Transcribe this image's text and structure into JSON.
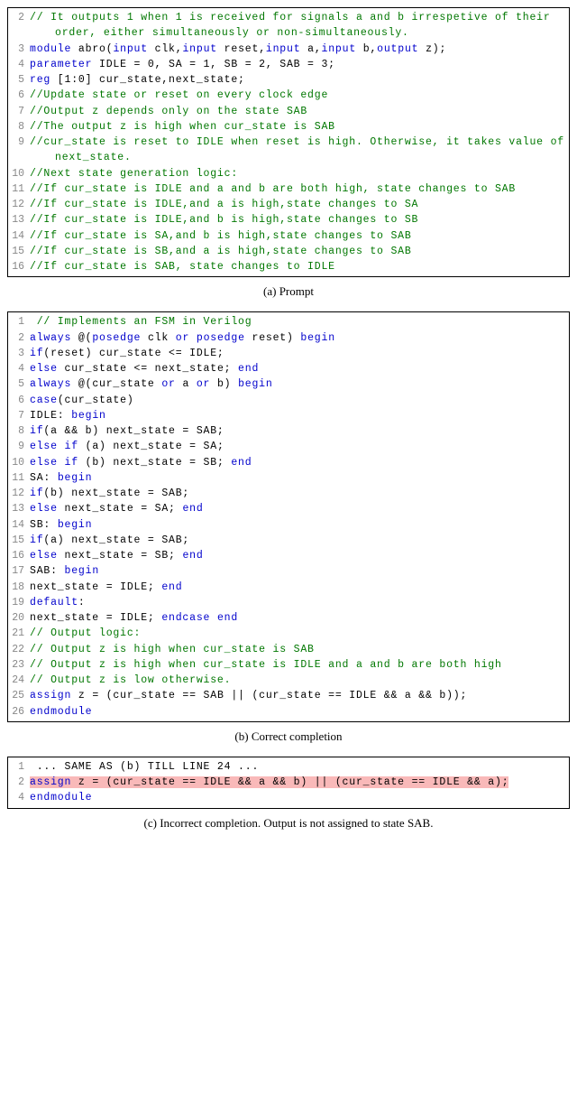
{
  "captions": {
    "a": "(a) Prompt",
    "b": "(b) Correct completion",
    "c": "(c) Incorrect completion. Output is not assigned to state SAB."
  },
  "blockA": [
    {
      "n": "2",
      "spans": [
        {
          "cls": "cm",
          "t": "// It outputs 1 when 1 is received for signals a and b irrespetive of their order, either simultaneously or non-simultaneously."
        }
      ]
    },
    {
      "n": "3",
      "spans": [
        {
          "cls": "kw",
          "t": "module"
        },
        {
          "cls": "txt",
          "t": " abro("
        },
        {
          "cls": "kw",
          "t": "input"
        },
        {
          "cls": "txt",
          "t": " clk,"
        },
        {
          "cls": "kw",
          "t": "input"
        },
        {
          "cls": "txt",
          "t": " reset,"
        },
        {
          "cls": "kw",
          "t": "input"
        },
        {
          "cls": "txt",
          "t": " a,"
        },
        {
          "cls": "kw",
          "t": "input"
        },
        {
          "cls": "txt",
          "t": " b,"
        },
        {
          "cls": "kw",
          "t": "output"
        },
        {
          "cls": "txt",
          "t": " z);"
        }
      ]
    },
    {
      "n": "4",
      "spans": [
        {
          "cls": "kw",
          "t": "parameter"
        },
        {
          "cls": "txt",
          "t": " IDLE = 0, SA = 1, SB = 2, SAB = 3;"
        }
      ]
    },
    {
      "n": "5",
      "spans": [
        {
          "cls": "kw",
          "t": "reg"
        },
        {
          "cls": "txt",
          "t": " [1:0] cur_state,next_state;"
        }
      ]
    },
    {
      "n": "6",
      "spans": [
        {
          "cls": "cm",
          "t": "//Update state or reset on every clock edge"
        }
      ]
    },
    {
      "n": "7",
      "spans": [
        {
          "cls": "cm",
          "t": "//Output z depends only on the state SAB"
        }
      ]
    },
    {
      "n": "8",
      "spans": [
        {
          "cls": "cm",
          "t": "//The output z is high when cur_state is SAB"
        }
      ]
    },
    {
      "n": "9",
      "spans": [
        {
          "cls": "cm",
          "t": "//cur_state is reset to IDLE when reset is high. Otherwise, it takes value of next_state."
        }
      ]
    },
    {
      "n": "10",
      "spans": [
        {
          "cls": "cm",
          "t": "//Next state generation logic:"
        }
      ]
    },
    {
      "n": "11",
      "spans": [
        {
          "cls": "cm",
          "t": "//If cur_state is IDLE and a and b are both high, state changes to SAB"
        }
      ]
    },
    {
      "n": "12",
      "spans": [
        {
          "cls": "cm",
          "t": "//If cur_state is IDLE,and a is high,state changes to SA"
        }
      ]
    },
    {
      "n": "13",
      "spans": [
        {
          "cls": "cm",
          "t": "//If cur_state is IDLE,and b is high,state changes to SB"
        }
      ]
    },
    {
      "n": "14",
      "spans": [
        {
          "cls": "cm",
          "t": "//If cur_state is SA,and b is high,state changes to SAB"
        }
      ]
    },
    {
      "n": "15",
      "spans": [
        {
          "cls": "cm",
          "t": "//If cur_state is SB,and a is high,state changes to SAB"
        }
      ]
    },
    {
      "n": "16",
      "spans": [
        {
          "cls": "cm",
          "t": "//If cur_state is SAB, state changes to IDLE"
        }
      ]
    }
  ],
  "blockB": [
    {
      "n": "1",
      "spans": [
        {
          "cls": "cm",
          "t": " // Implements an FSM in Verilog"
        }
      ]
    },
    {
      "n": "2",
      "spans": [
        {
          "cls": "kw",
          "t": "always"
        },
        {
          "cls": "txt",
          "t": " @("
        },
        {
          "cls": "kw",
          "t": "posedge"
        },
        {
          "cls": "txt",
          "t": " clk "
        },
        {
          "cls": "kw",
          "t": "or"
        },
        {
          "cls": "txt",
          "t": " "
        },
        {
          "cls": "kw",
          "t": "posedge"
        },
        {
          "cls": "txt",
          "t": " reset) "
        },
        {
          "cls": "kw",
          "t": "begin"
        }
      ]
    },
    {
      "n": "3",
      "spans": [
        {
          "cls": "kw",
          "t": "if"
        },
        {
          "cls": "txt",
          "t": "(reset) cur_state <= IDLE;"
        }
      ]
    },
    {
      "n": "4",
      "spans": [
        {
          "cls": "kw",
          "t": "else"
        },
        {
          "cls": "txt",
          "t": " cur_state <= next_state; "
        },
        {
          "cls": "kw",
          "t": "end"
        }
      ]
    },
    {
      "n": "5",
      "spans": [
        {
          "cls": "kw",
          "t": "always"
        },
        {
          "cls": "txt",
          "t": " @(cur_state "
        },
        {
          "cls": "kw",
          "t": "or"
        },
        {
          "cls": "txt",
          "t": " a "
        },
        {
          "cls": "kw",
          "t": "or"
        },
        {
          "cls": "txt",
          "t": " b) "
        },
        {
          "cls": "kw",
          "t": "begin"
        }
      ]
    },
    {
      "n": "6",
      "spans": [
        {
          "cls": "kw",
          "t": "case"
        },
        {
          "cls": "txt",
          "t": "(cur_state)"
        }
      ]
    },
    {
      "n": "7",
      "spans": [
        {
          "cls": "txt",
          "t": "IDLE: "
        },
        {
          "cls": "kw",
          "t": "begin"
        }
      ]
    },
    {
      "n": "8",
      "spans": [
        {
          "cls": "kw",
          "t": "if"
        },
        {
          "cls": "txt",
          "t": "(a && b) next_state = SAB;"
        }
      ]
    },
    {
      "n": "9",
      "spans": [
        {
          "cls": "kw",
          "t": "else"
        },
        {
          "cls": "txt",
          "t": " "
        },
        {
          "cls": "kw",
          "t": "if"
        },
        {
          "cls": "txt",
          "t": " (a) next_state = SA;"
        }
      ]
    },
    {
      "n": "10",
      "spans": [
        {
          "cls": "kw",
          "t": "else"
        },
        {
          "cls": "txt",
          "t": " "
        },
        {
          "cls": "kw",
          "t": "if"
        },
        {
          "cls": "txt",
          "t": " (b) next_state = SB; "
        },
        {
          "cls": "kw",
          "t": "end"
        }
      ]
    },
    {
      "n": "11",
      "spans": [
        {
          "cls": "txt",
          "t": "SA: "
        },
        {
          "cls": "kw",
          "t": "begin"
        }
      ]
    },
    {
      "n": "12",
      "spans": [
        {
          "cls": "kw",
          "t": "if"
        },
        {
          "cls": "txt",
          "t": "(b) next_state = SAB;"
        }
      ]
    },
    {
      "n": "13",
      "spans": [
        {
          "cls": "kw",
          "t": "else"
        },
        {
          "cls": "txt",
          "t": " next_state = SA; "
        },
        {
          "cls": "kw",
          "t": "end"
        }
      ]
    },
    {
      "n": "14",
      "spans": [
        {
          "cls": "txt",
          "t": "SB: "
        },
        {
          "cls": "kw",
          "t": "begin"
        }
      ]
    },
    {
      "n": "15",
      "spans": [
        {
          "cls": "kw",
          "t": "if"
        },
        {
          "cls": "txt",
          "t": "(a) next_state = SAB;"
        }
      ]
    },
    {
      "n": "16",
      "spans": [
        {
          "cls": "kw",
          "t": "else"
        },
        {
          "cls": "txt",
          "t": " next_state = SB; "
        },
        {
          "cls": "kw",
          "t": "end"
        }
      ]
    },
    {
      "n": "17",
      "spans": [
        {
          "cls": "txt",
          "t": "SAB: "
        },
        {
          "cls": "kw",
          "t": "begin"
        }
      ]
    },
    {
      "n": "18",
      "spans": [
        {
          "cls": "txt",
          "t": "next_state = IDLE; "
        },
        {
          "cls": "kw",
          "t": "end"
        }
      ]
    },
    {
      "n": "19",
      "spans": [
        {
          "cls": "kw",
          "t": "default"
        },
        {
          "cls": "txt",
          "t": ":"
        }
      ]
    },
    {
      "n": "20",
      "spans": [
        {
          "cls": "txt",
          "t": "next_state = IDLE; "
        },
        {
          "cls": "kw",
          "t": "endcase"
        },
        {
          "cls": "txt",
          "t": " "
        },
        {
          "cls": "kw",
          "t": "end"
        }
      ]
    },
    {
      "n": "21",
      "spans": [
        {
          "cls": "cm",
          "t": "// Output logic:"
        }
      ]
    },
    {
      "n": "22",
      "spans": [
        {
          "cls": "cm",
          "t": "// Output z is high when cur_state is SAB"
        }
      ]
    },
    {
      "n": "23",
      "spans": [
        {
          "cls": "cm",
          "t": "// Output z is high when cur_state is IDLE and a and b are both high"
        }
      ]
    },
    {
      "n": "24",
      "spans": [
        {
          "cls": "cm",
          "t": "// Output z is low otherwise."
        }
      ]
    },
    {
      "n": "25",
      "spans": [
        {
          "cls": "kw",
          "t": "assign"
        },
        {
          "cls": "txt",
          "t": " z = (cur_state == SAB || (cur_state == IDLE && a && b));"
        }
      ]
    },
    {
      "n": "26",
      "spans": [
        {
          "cls": "kw",
          "t": "endmodule"
        }
      ]
    }
  ],
  "blockC": [
    {
      "n": "1",
      "spans": [
        {
          "cls": "txt",
          "t": " ... SAME AS (b) TILL LINE 24 ..."
        }
      ]
    },
    {
      "n": "2",
      "hl": true,
      "spans": [
        {
          "cls": "kw",
          "t": "assign"
        },
        {
          "cls": "txt",
          "t": " z = (cur_state == IDLE && a && b) || (cur_state == IDLE && a);"
        }
      ]
    },
    {
      "n": "4",
      "spans": [
        {
          "cls": "kw",
          "t": "endmodule"
        }
      ]
    }
  ]
}
